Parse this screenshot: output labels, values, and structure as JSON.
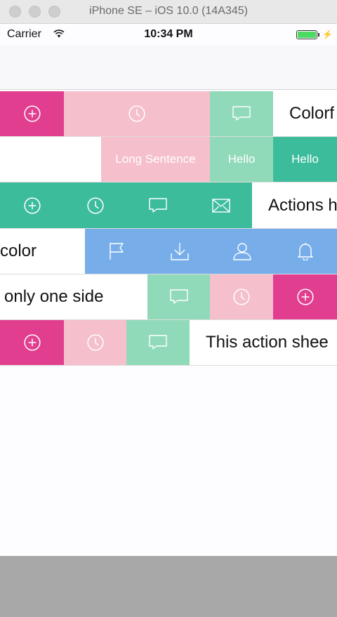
{
  "window": {
    "title": "iPhone SE – iOS 10.0 (14A345)"
  },
  "statusbar": {
    "carrier": "Carrier",
    "time": "10:34 PM"
  },
  "colors": {
    "pink": "#e13e90",
    "light_pink": "#f5bfcb",
    "mint": "#90dab9",
    "teal": "#3dbc9c",
    "blue": "#77aeea"
  },
  "rows": [
    {
      "text": "Colorf",
      "actions": [
        "plus-circle-icon",
        "clock-icon",
        "comment-icon"
      ]
    },
    {
      "actions": [
        "Long Sentence",
        "Hello",
        "Hello"
      ]
    },
    {
      "text": "Actions h",
      "actions": [
        "plus-circle-icon",
        "clock-icon",
        "comment-icon",
        "mail-icon"
      ]
    },
    {
      "text": "color",
      "actions": [
        "flag-icon",
        "download-icon",
        "user-icon",
        "bell-icon"
      ]
    },
    {
      "text": "only one side",
      "actions": [
        "comment-icon",
        "clock-icon",
        "plus-circle-icon"
      ]
    },
    {
      "text": "This action shee",
      "actions": [
        "plus-circle-icon",
        "clock-icon",
        "comment-icon"
      ]
    }
  ],
  "buttons": {
    "long_sentence": "Long Sentence",
    "hello": "Hello"
  }
}
